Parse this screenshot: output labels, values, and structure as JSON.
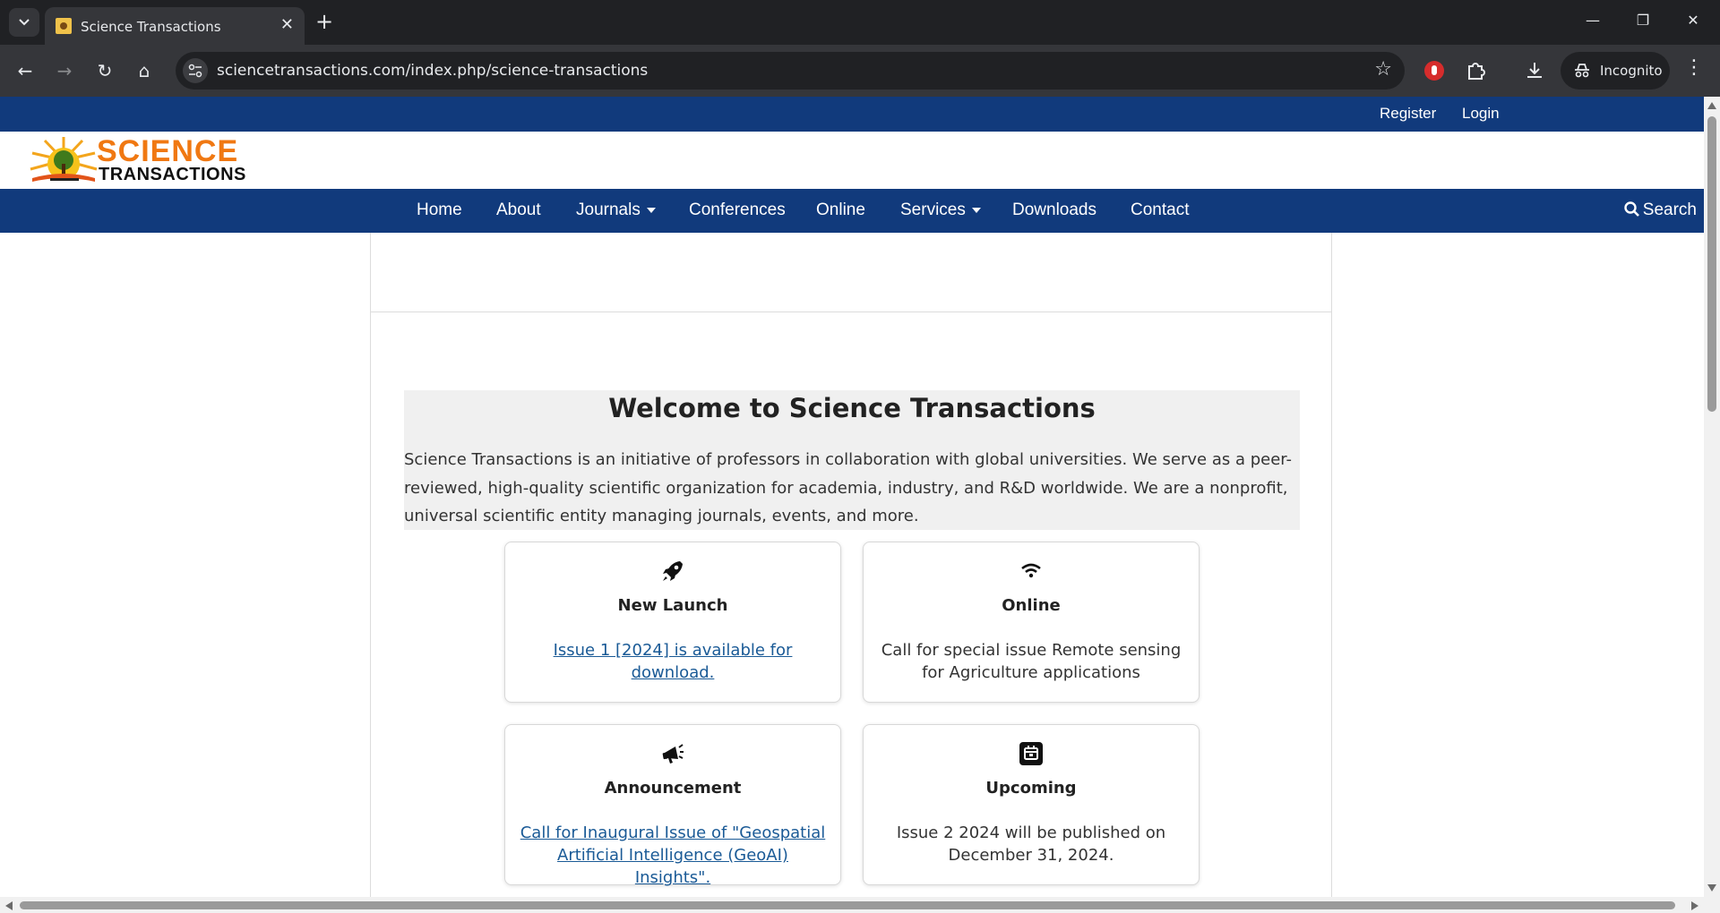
{
  "browser": {
    "tab_title": "Science Transactions",
    "tab_close": "✕",
    "new_tab": "+",
    "url": "sciencetransactions.com/index.php/science-transactions",
    "incognito_label": "Incognito",
    "minimize": "—",
    "restore": "❐",
    "close": "✕",
    "back": "←",
    "forward": "→",
    "reload": "↻",
    "home": "⌂",
    "star": "☆",
    "menu": "⋮"
  },
  "topbar": {
    "register": "Register",
    "login": "Login"
  },
  "logo": {
    "line1": "SCIENCE",
    "line2": "TRANSACTIONS"
  },
  "nav": {
    "items": [
      {
        "label": "Home"
      },
      {
        "label": "About"
      },
      {
        "label": "Journals"
      },
      {
        "label": "Conferences"
      },
      {
        "label": "Online"
      },
      {
        "label": "Services"
      },
      {
        "label": "Downloads"
      },
      {
        "label": "Contact"
      }
    ],
    "search_label": "Search"
  },
  "welcome": {
    "title": "Welcome to Science Transactions",
    "text": "Science Transactions is an initiative of professors in collaboration with global universities. We serve as a peer-reviewed, high-quality scientific organization for academia, industry, and R&D worldwide. We are a nonprofit, universal scientific entity managing journals, events, and more."
  },
  "cards": [
    {
      "title": "New Launch",
      "body": "Issue 1 [2024] is available for download.",
      "icon": "rocket-icon"
    },
    {
      "title": "Online",
      "body": "Call for special issue Remote sensing for Agriculture applications",
      "icon": "wifi-icon"
    },
    {
      "title": "Announcement",
      "body": "Call for Inaugural Issue of \"Geospatial Artificial Intelligence (GeoAI) Insights\".",
      "icon": "megaphone-icon"
    },
    {
      "title": "Upcoming",
      "body": "Issue 2 2024 will be published on December 31, 2024.",
      "icon": "calendar-icon"
    }
  ],
  "colors": {
    "nav_bg": "#113a7c",
    "link": "#1a5a96",
    "logo_orange": "#f07812"
  }
}
